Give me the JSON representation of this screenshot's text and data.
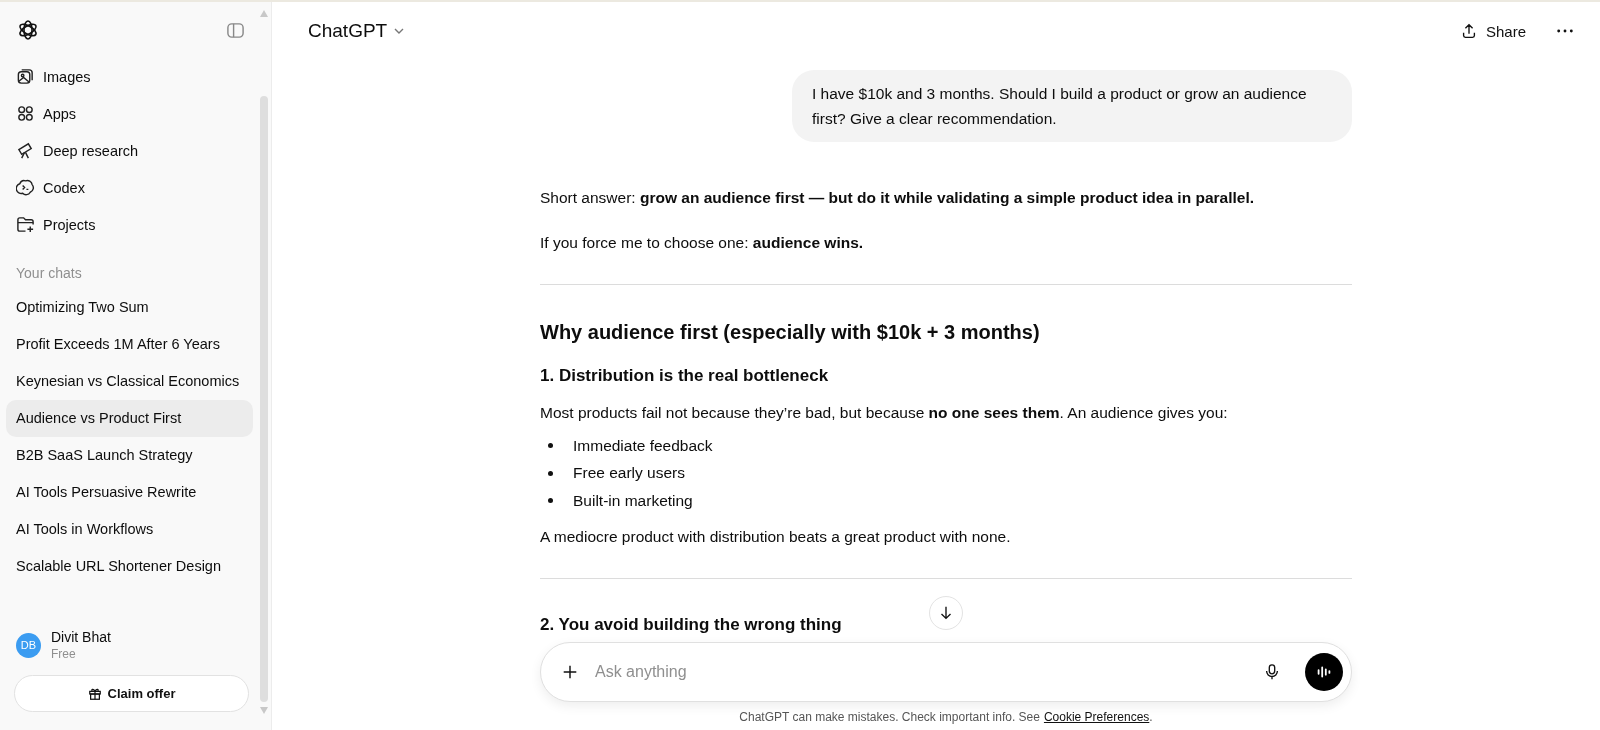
{
  "sidebar": {
    "nav": [
      {
        "label": "Images"
      },
      {
        "label": "Apps"
      },
      {
        "label": "Deep research"
      },
      {
        "label": "Codex"
      },
      {
        "label": "Projects"
      }
    ],
    "section_title": "Your chats",
    "chats": [
      {
        "title": "Optimizing Two Sum",
        "selected": false
      },
      {
        "title": "Profit Exceeds 1M After 6 Years",
        "selected": false
      },
      {
        "title": "Keynesian vs Classical Economics",
        "selected": false
      },
      {
        "title": "Audience vs Product First",
        "selected": true
      },
      {
        "title": "B2B SaaS Launch Strategy",
        "selected": false
      },
      {
        "title": "AI Tools Persuasive Rewrite",
        "selected": false
      },
      {
        "title": "AI Tools in Workflows",
        "selected": false
      },
      {
        "title": "Scalable URL Shortener Design",
        "selected": false
      }
    ],
    "user": {
      "initials": "DB",
      "name": "Divit Bhat",
      "plan": "Free",
      "color": "#3b9cf1"
    },
    "claim_button": "Claim offer"
  },
  "header": {
    "model": "ChatGPT",
    "share": "Share"
  },
  "user_message": "I have $10k and 3 months. Should I build a product or grow an audience first? Give a clear recommendation.",
  "response": [
    {
      "kind": "paragraph",
      "text": "Short answer: **grow an audience first — but do it while validating a simple product idea in parallel.**"
    },
    {
      "kind": "paragraph",
      "text": "If you force me to choose one: **audience wins.**"
    },
    {
      "kind": "rule"
    },
    {
      "kind": "heading",
      "text": "Why audience first (especially with $10k + 3 months)"
    },
    {
      "kind": "subheading",
      "text": "1. Distribution is the real bottleneck"
    },
    {
      "kind": "paragraph",
      "text": "Most products fail not because they’re bad, but because **no one sees them**. An audience gives you:"
    },
    {
      "kind": "list",
      "items": [
        "Immediate feedback",
        "Free early users",
        "Built-in marketing"
      ]
    },
    {
      "kind": "paragraph",
      "text": "A mediocre product with distribution beats a great product with none."
    },
    {
      "kind": "rule"
    },
    {
      "kind": "subheading",
      "text": "2. You avoid building the wrong thing"
    }
  ],
  "composer": {
    "placeholder": "Ask anything"
  },
  "footer": {
    "text": "ChatGPT can make mistakes. Check important info. See",
    "link": "Cookie Preferences",
    "end": "."
  }
}
